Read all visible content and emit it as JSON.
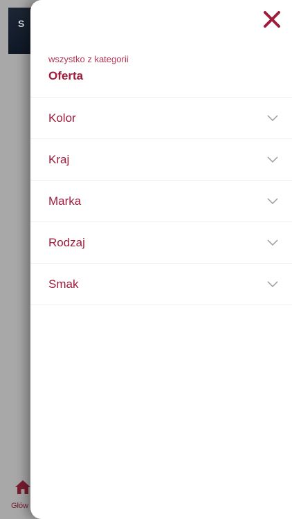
{
  "background": {
    "banner_text": "S",
    "nav_label": "Głów"
  },
  "drawer": {
    "subtitle": "wszystko z kategorii",
    "title": "Oferta",
    "filters": [
      {
        "label": "Kolor",
        "icon": "chevron-down-icon"
      },
      {
        "label": "Kraj",
        "icon": "chevron-down-icon"
      },
      {
        "label": "Marka",
        "icon": "chevron-down-icon"
      },
      {
        "label": "Rodzaj",
        "icon": "chevron-down-icon"
      },
      {
        "label": "Smak",
        "icon": "chevron-down-icon"
      }
    ]
  },
  "colors": {
    "accent": "#9e1b3b",
    "subtitle": "#b23452",
    "chevron": "#9a9a9a",
    "overlay": "#a8a8a8"
  }
}
